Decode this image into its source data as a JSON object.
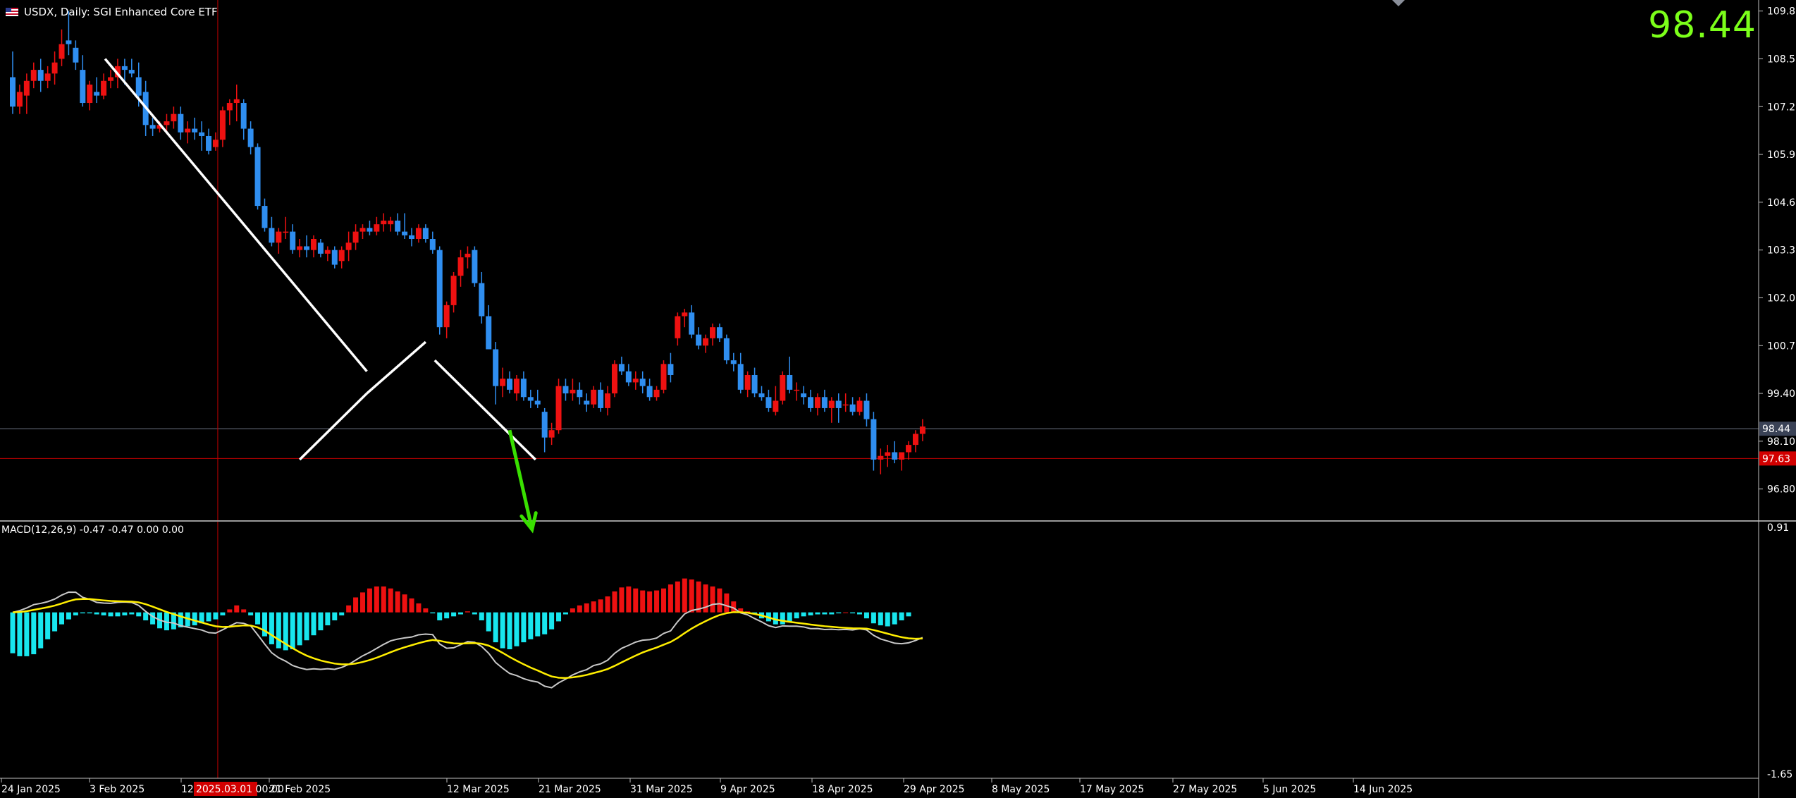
{
  "window": {
    "symbol": "USDX",
    "timeframe": "Daily",
    "title": "USDX, Daily:  SGI Enhanced Core ETF"
  },
  "big_price": "98.44",
  "price_axis": {
    "labels": [
      "109.80",
      "108.50",
      "107.20",
      "105.90",
      "104.60",
      "103.30",
      "102.00",
      "100.70",
      "99.40",
      "98.10",
      "96.80"
    ],
    "current_price": "98.44",
    "crosshair_price": "97.63",
    "current_tag_color": "#3a4256",
    "crosshair_tag_color": "#d10000"
  },
  "macd_axis": {
    "labels": [
      "0.91",
      "-1.65"
    ]
  },
  "macd_label": "MACD(12,26,9) -0.47 -0.47 0.00 0.00",
  "time_axis": {
    "labels": [
      "24 Jan 2025",
      "3 Feb 2025",
      "12 Feb 2025",
      "21 Feb 2025",
      "12 Mar 2025",
      "21 Mar 2025",
      "31 Mar 2025",
      "9 Apr 2025",
      "18 Apr 2025",
      "29 Apr 2025",
      "8 May 2025",
      "17 May 2025",
      "27 May 2025",
      "5 Jun 2025",
      "14 Jun 2025"
    ],
    "crosshair_label": "2025.03.01 00:00"
  },
  "colors": {
    "bull": "#ee1111",
    "bear": "#2f8ef0",
    "hist_pos": "#ee1111",
    "hist_neg": "#18e6ee",
    "macd_line": "#c8c8c8",
    "signal_line": "#ffee00",
    "trendline": "#ffffff",
    "forecast_arrow": "#39e000",
    "big_price": "#7cff1a"
  },
  "chart_data": {
    "type": "candlestick",
    "title": "USDX, Daily:  SGI Enhanced Core ETF",
    "ylim": [
      95.95,
      110.1
    ],
    "candles": [
      [
        108.0,
        108.7,
        107.0,
        107.2
      ],
      [
        107.2,
        107.8,
        107.0,
        107.6
      ],
      [
        107.5,
        108.1,
        107.0,
        107.9
      ],
      [
        107.9,
        108.4,
        107.7,
        108.2
      ],
      [
        108.2,
        108.5,
        107.6,
        107.9
      ],
      [
        107.9,
        108.3,
        107.7,
        108.1
      ],
      [
        108.1,
        108.7,
        107.8,
        108.4
      ],
      [
        108.5,
        109.3,
        108.3,
        108.9
      ],
      [
        109.0,
        109.8,
        108.6,
        108.9
      ],
      [
        108.8,
        109.0,
        108.2,
        108.4
      ],
      [
        108.2,
        108.6,
        107.2,
        107.3
      ],
      [
        107.3,
        107.9,
        107.1,
        107.8
      ],
      [
        107.6,
        108.0,
        107.3,
        107.5
      ],
      [
        107.5,
        108.1,
        107.4,
        107.9
      ],
      [
        107.9,
        108.2,
        107.7,
        108.0
      ],
      [
        108.0,
        108.5,
        107.7,
        108.3
      ],
      [
        108.3,
        108.5,
        107.8,
        108.2
      ],
      [
        108.2,
        108.5,
        108.0,
        108.1
      ],
      [
        108.0,
        108.4,
        107.2,
        107.5
      ],
      [
        107.6,
        107.9,
        106.4,
        106.7
      ],
      [
        106.7,
        106.9,
        106.4,
        106.6
      ],
      [
        106.6,
        106.8,
        106.5,
        106.7
      ],
      [
        106.7,
        107.0,
        106.5,
        106.8
      ],
      [
        106.8,
        107.2,
        106.6,
        107.0
      ],
      [
        107.0,
        107.2,
        106.3,
        106.5
      ],
      [
        106.5,
        106.8,
        106.2,
        106.6
      ],
      [
        106.6,
        106.9,
        106.3,
        106.5
      ],
      [
        106.5,
        106.8,
        106.0,
        106.4
      ],
      [
        106.4,
        106.6,
        105.9,
        106.0
      ],
      [
        106.1,
        106.5,
        106.0,
        106.3
      ],
      [
        106.3,
        107.2,
        106.1,
        107.1
      ],
      [
        107.1,
        107.4,
        106.7,
        107.3
      ],
      [
        107.3,
        107.8,
        106.8,
        107.4
      ],
      [
        107.3,
        107.4,
        106.3,
        106.6
      ],
      [
        106.6,
        106.8,
        105.9,
        106.1
      ],
      [
        106.1,
        106.2,
        104.4,
        104.5
      ],
      [
        104.5,
        104.7,
        103.8,
        103.9
      ],
      [
        103.9,
        104.2,
        103.4,
        103.5
      ],
      [
        103.5,
        103.9,
        103.2,
        103.8
      ],
      [
        103.8,
        104.2,
        103.6,
        103.8
      ],
      [
        103.8,
        104.0,
        103.2,
        103.3
      ],
      [
        103.3,
        103.6,
        103.1,
        103.4
      ],
      [
        103.4,
        103.7,
        103.1,
        103.3
      ],
      [
        103.3,
        103.7,
        103.1,
        103.6
      ],
      [
        103.5,
        103.6,
        103.1,
        103.2
      ],
      [
        103.2,
        103.4,
        103.0,
        103.3
      ],
      [
        103.3,
        103.4,
        102.8,
        102.9
      ],
      [
        103.0,
        103.4,
        102.8,
        103.3
      ],
      [
        103.3,
        103.8,
        103.0,
        103.5
      ],
      [
        103.5,
        104.0,
        103.3,
        103.8
      ],
      [
        103.8,
        104.0,
        103.6,
        103.9
      ],
      [
        103.9,
        104.1,
        103.7,
        103.8
      ],
      [
        103.8,
        104.2,
        103.7,
        104.0
      ],
      [
        104.0,
        104.3,
        103.8,
        104.1
      ],
      [
        104.0,
        104.2,
        103.8,
        104.1
      ],
      [
        104.1,
        104.3,
        103.7,
        103.8
      ],
      [
        103.8,
        104.3,
        103.6,
        103.7
      ],
      [
        103.7,
        103.9,
        103.4,
        103.6
      ],
      [
        103.6,
        104.0,
        103.5,
        103.9
      ],
      [
        103.9,
        104.0,
        103.5,
        103.6
      ],
      [
        103.6,
        103.8,
        103.2,
        103.3
      ],
      [
        103.3,
        103.4,
        101.0,
        101.2
      ],
      [
        101.2,
        101.9,
        100.9,
        101.8
      ],
      [
        101.8,
        102.7,
        101.6,
        102.6
      ],
      [
        102.6,
        103.3,
        102.3,
        103.1
      ],
      [
        103.1,
        103.4,
        102.8,
        103.2
      ],
      [
        103.3,
        103.4,
        102.3,
        102.4
      ],
      [
        102.4,
        102.7,
        101.3,
        101.5
      ],
      [
        101.5,
        101.8,
        100.6,
        100.6
      ],
      [
        100.6,
        100.8,
        99.1,
        99.6
      ],
      [
        99.6,
        100.1,
        99.3,
        99.8
      ],
      [
        99.8,
        100.0,
        99.4,
        99.5
      ],
      [
        99.4,
        99.9,
        99.2,
        99.8
      ],
      [
        99.8,
        100.0,
        99.2,
        99.3
      ],
      [
        99.3,
        99.5,
        99.0,
        99.2
      ],
      [
        99.2,
        99.5,
        99.0,
        99.1
      ],
      [
        98.9,
        99.0,
        97.8,
        98.2
      ],
      [
        98.2,
        98.6,
        98.0,
        98.4
      ],
      [
        98.4,
        99.8,
        98.3,
        99.6
      ],
      [
        99.6,
        99.8,
        99.2,
        99.4
      ],
      [
        99.4,
        99.8,
        99.2,
        99.5
      ],
      [
        99.5,
        99.7,
        99.1,
        99.3
      ],
      [
        99.2,
        99.4,
        98.9,
        99.1
      ],
      [
        99.1,
        99.6,
        99.0,
        99.5
      ],
      [
        99.5,
        99.7,
        98.9,
        99.0
      ],
      [
        99.0,
        99.6,
        98.8,
        99.4
      ],
      [
        99.4,
        100.3,
        99.3,
        100.2
      ],
      [
        100.2,
        100.4,
        99.9,
        100.0
      ],
      [
        100.0,
        100.2,
        99.6,
        99.7
      ],
      [
        99.7,
        100.0,
        99.5,
        99.8
      ],
      [
        99.8,
        100.0,
        99.4,
        99.6
      ],
      [
        99.6,
        99.8,
        99.2,
        99.3
      ],
      [
        99.3,
        99.6,
        99.2,
        99.5
      ],
      [
        99.5,
        100.3,
        99.4,
        100.2
      ],
      [
        100.2,
        100.5,
        99.7,
        99.9
      ],
      [
        100.9,
        101.6,
        100.7,
        101.5
      ],
      [
        101.5,
        101.7,
        101.2,
        101.6
      ],
      [
        101.6,
        101.8,
        100.9,
        101.0
      ],
      [
        101.0,
        101.2,
        100.6,
        100.7
      ],
      [
        100.7,
        101.0,
        100.5,
        100.9
      ],
      [
        100.9,
        101.3,
        100.7,
        101.2
      ],
      [
        101.2,
        101.3,
        100.8,
        100.9
      ],
      [
        100.9,
        101.0,
        100.2,
        100.3
      ],
      [
        100.3,
        100.5,
        100.0,
        100.2
      ],
      [
        100.2,
        100.5,
        99.4,
        99.5
      ],
      [
        99.5,
        100.0,
        99.3,
        99.9
      ],
      [
        99.9,
        100.1,
        99.3,
        99.4
      ],
      [
        99.4,
        99.6,
        99.2,
        99.3
      ],
      [
        99.3,
        99.5,
        98.9,
        99.0
      ],
      [
        98.9,
        99.6,
        98.8,
        99.2
      ],
      [
        99.2,
        100.0,
        99.1,
        99.9
      ],
      [
        99.9,
        100.4,
        99.4,
        99.5
      ],
      [
        99.5,
        99.7,
        99.2,
        99.5
      ],
      [
        99.4,
        99.6,
        99.1,
        99.3
      ],
      [
        99.3,
        99.5,
        98.9,
        99.0
      ],
      [
        99.0,
        99.4,
        98.8,
        99.3
      ],
      [
        99.3,
        99.5,
        98.9,
        99.0
      ],
      [
        99.0,
        99.3,
        98.6,
        99.2
      ],
      [
        99.2,
        99.4,
        98.6,
        99.0
      ],
      [
        99.1,
        99.4,
        98.9,
        99.1
      ],
      [
        99.1,
        99.3,
        98.8,
        98.9
      ],
      [
        98.9,
        99.3,
        98.8,
        99.2
      ],
      [
        99.2,
        99.4,
        98.5,
        98.7
      ],
      [
        98.7,
        98.9,
        97.3,
        97.6
      ],
      [
        97.6,
        97.9,
        97.2,
        97.7
      ],
      [
        97.7,
        98.0,
        97.4,
        97.8
      ],
      [
        97.8,
        98.1,
        97.5,
        97.6
      ],
      [
        97.6,
        97.8,
        97.3,
        97.8
      ],
      [
        97.8,
        98.1,
        97.6,
        98.0
      ],
      [
        98.0,
        98.4,
        97.8,
        98.3
      ],
      [
        98.3,
        98.7,
        98.1,
        98.5
      ]
    ],
    "trendlines": [
      {
        "from": [
          13.2,
          108.5
        ],
        "to": [
          50.6,
          100.0
        ]
      },
      {
        "from": [
          41.0,
          97.6
        ],
        "to": [
          50.6,
          99.4
        ]
      },
      {
        "from": [
          50.6,
          99.4
        ],
        "to": [
          59.0,
          100.8
        ]
      },
      {
        "from": [
          60.3,
          100.3
        ],
        "to": [
          74.7,
          97.6
        ]
      }
    ],
    "forecast_arrow": {
      "from": [
        71.0,
        98.4
      ],
      "to": [
        74.2,
        95.7
      ]
    },
    "macd": {
      "ylim": [
        -1.65,
        0.91
      ],
      "histogram": [
        -0.41,
        -0.44,
        -0.44,
        -0.42,
        -0.36,
        -0.27,
        -0.19,
        -0.12,
        -0.07,
        -0.03,
        -0.01,
        -0.01,
        -0.02,
        -0.03,
        -0.04,
        -0.04,
        -0.03,
        -0.02,
        -0.04,
        -0.08,
        -0.12,
        -0.16,
        -0.18,
        -0.17,
        -0.15,
        -0.14,
        -0.13,
        -0.11,
        -0.09,
        -0.07,
        -0.03,
        0.03,
        0.07,
        0.03,
        -0.03,
        -0.12,
        -0.24,
        -0.32,
        -0.36,
        -0.38,
        -0.37,
        -0.33,
        -0.28,
        -0.23,
        -0.18,
        -0.13,
        -0.08,
        -0.03,
        0.07,
        0.15,
        0.2,
        0.24,
        0.26,
        0.26,
        0.24,
        0.21,
        0.18,
        0.14,
        0.09,
        0.04,
        -0.01,
        -0.08,
        -0.06,
        -0.04,
        -0.02,
        0.01,
        -0.02,
        -0.08,
        -0.19,
        -0.3,
        -0.36,
        -0.37,
        -0.34,
        -0.3,
        -0.27,
        -0.24,
        -0.22,
        -0.17,
        -0.09,
        -0.02,
        0.04,
        0.07,
        0.09,
        0.11,
        0.13,
        0.16,
        0.21,
        0.25,
        0.26,
        0.24,
        0.22,
        0.21,
        0.22,
        0.24,
        0.28,
        0.31,
        0.34,
        0.33,
        0.31,
        0.28,
        0.26,
        0.24,
        0.19,
        0.11,
        0.04,
        0.01,
        -0.02,
        -0.06,
        -0.09,
        -0.12,
        -0.12,
        -0.09,
        -0.06,
        -0.04,
        -0.03,
        -0.02,
        -0.02,
        -0.02,
        -0.01,
        0.0,
        -0.01,
        -0.02,
        -0.06,
        -0.11,
        -0.13,
        -0.14,
        -0.12,
        -0.08,
        -0.04
      ]
    }
  }
}
